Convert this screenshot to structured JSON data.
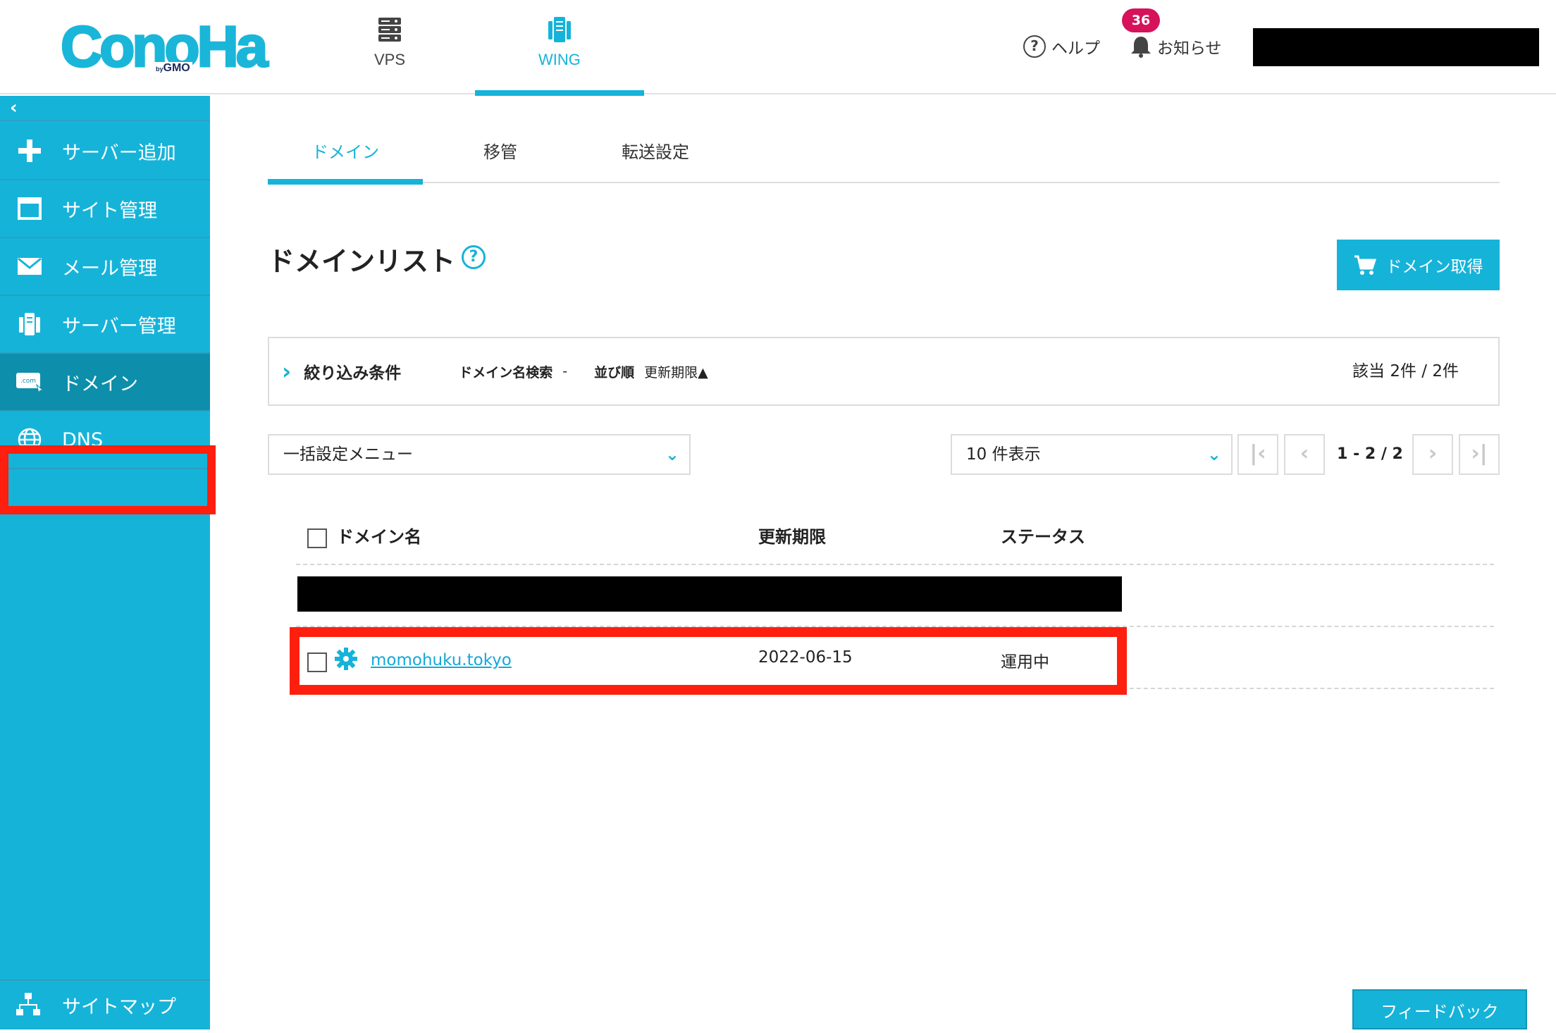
{
  "brand": {
    "logo_main": "ConoHa",
    "logo_by": "by",
    "logo_gmo": "GMO",
    "accent": "#16b3d9",
    "highlight": "#ff1f0f"
  },
  "header": {
    "nav": [
      {
        "label": "VPS",
        "icon": "server-stack-icon"
      },
      {
        "label": "WING",
        "icon": "wing-server-icon",
        "active": true
      }
    ],
    "help_label": "ヘルプ",
    "notice_label": "お知らせ",
    "notice_count": "36"
  },
  "sidebar": {
    "collapse_label": "‹",
    "items": [
      {
        "label": "サーバー追加",
        "icon": "plus-icon"
      },
      {
        "label": "サイト管理",
        "icon": "window-icon"
      },
      {
        "label": "メール管理",
        "icon": "mail-icon"
      },
      {
        "label": "サーバー管理",
        "icon": "server-icon"
      },
      {
        "label": "ドメイン",
        "icon": "domain-com-icon",
        "active": true
      },
      {
        "label": "DNS",
        "icon": "globe-icon"
      }
    ],
    "sitemap_label": "サイトマップ"
  },
  "tabs": [
    {
      "label": "ドメイン",
      "active": true
    },
    {
      "label": "移管"
    },
    {
      "label": "転送設定"
    }
  ],
  "page": {
    "title": "ドメインリスト",
    "help_glyph": "?",
    "get_domain_label": "ドメイン取得"
  },
  "filter": {
    "chevron": "›",
    "title": "絞り込み条件",
    "search_key": "ドメイン名検索",
    "search_value": "-",
    "sort_key": "並び順",
    "sort_value": "更新期限▲",
    "count": "該当 2件 / 2件"
  },
  "controls": {
    "bulk_menu": "一括設定メニュー",
    "per_page": "10 件表示",
    "first": "|‹",
    "prev": "‹",
    "range": "1 - 2 / 2",
    "next": "›",
    "last": "›|"
  },
  "table": {
    "headers": {
      "name": "ドメイン名",
      "expiry": "更新期限",
      "status": "ステータス"
    },
    "rows": [
      {
        "domain": "momohuku.tokyo",
        "expiry": "2022-06-15",
        "status": "運用中"
      }
    ]
  },
  "feedback_label": "フィードバック"
}
